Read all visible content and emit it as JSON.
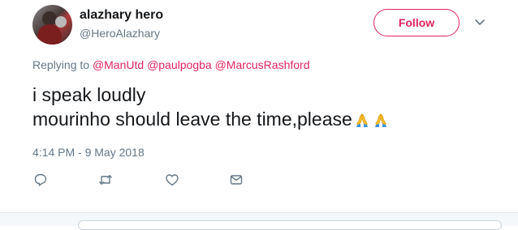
{
  "user": {
    "display_name": "alazhary hero",
    "handle": "@HeroAlazhary"
  },
  "follow_button_label": "Follow",
  "reply_context": {
    "prefix": "Replying to",
    "mentions": [
      "@ManUtd",
      "@paulpogba",
      "@MarcusRashford"
    ]
  },
  "tweet": {
    "line1": "i speak loudly",
    "line2": "mourinho should leave the time,please",
    "emoji": [
      "folded-hands-icon",
      "folded-hands-icon"
    ],
    "timestamp": "4:14 PM - 9 May 2018"
  },
  "actions": [
    "reply-icon",
    "retweet-icon",
    "like-icon",
    "direct-message-icon"
  ],
  "colors": {
    "accent": "#e0245e",
    "secondary_text": "#657786",
    "primary_text": "#14171a",
    "icon": "#657786"
  }
}
